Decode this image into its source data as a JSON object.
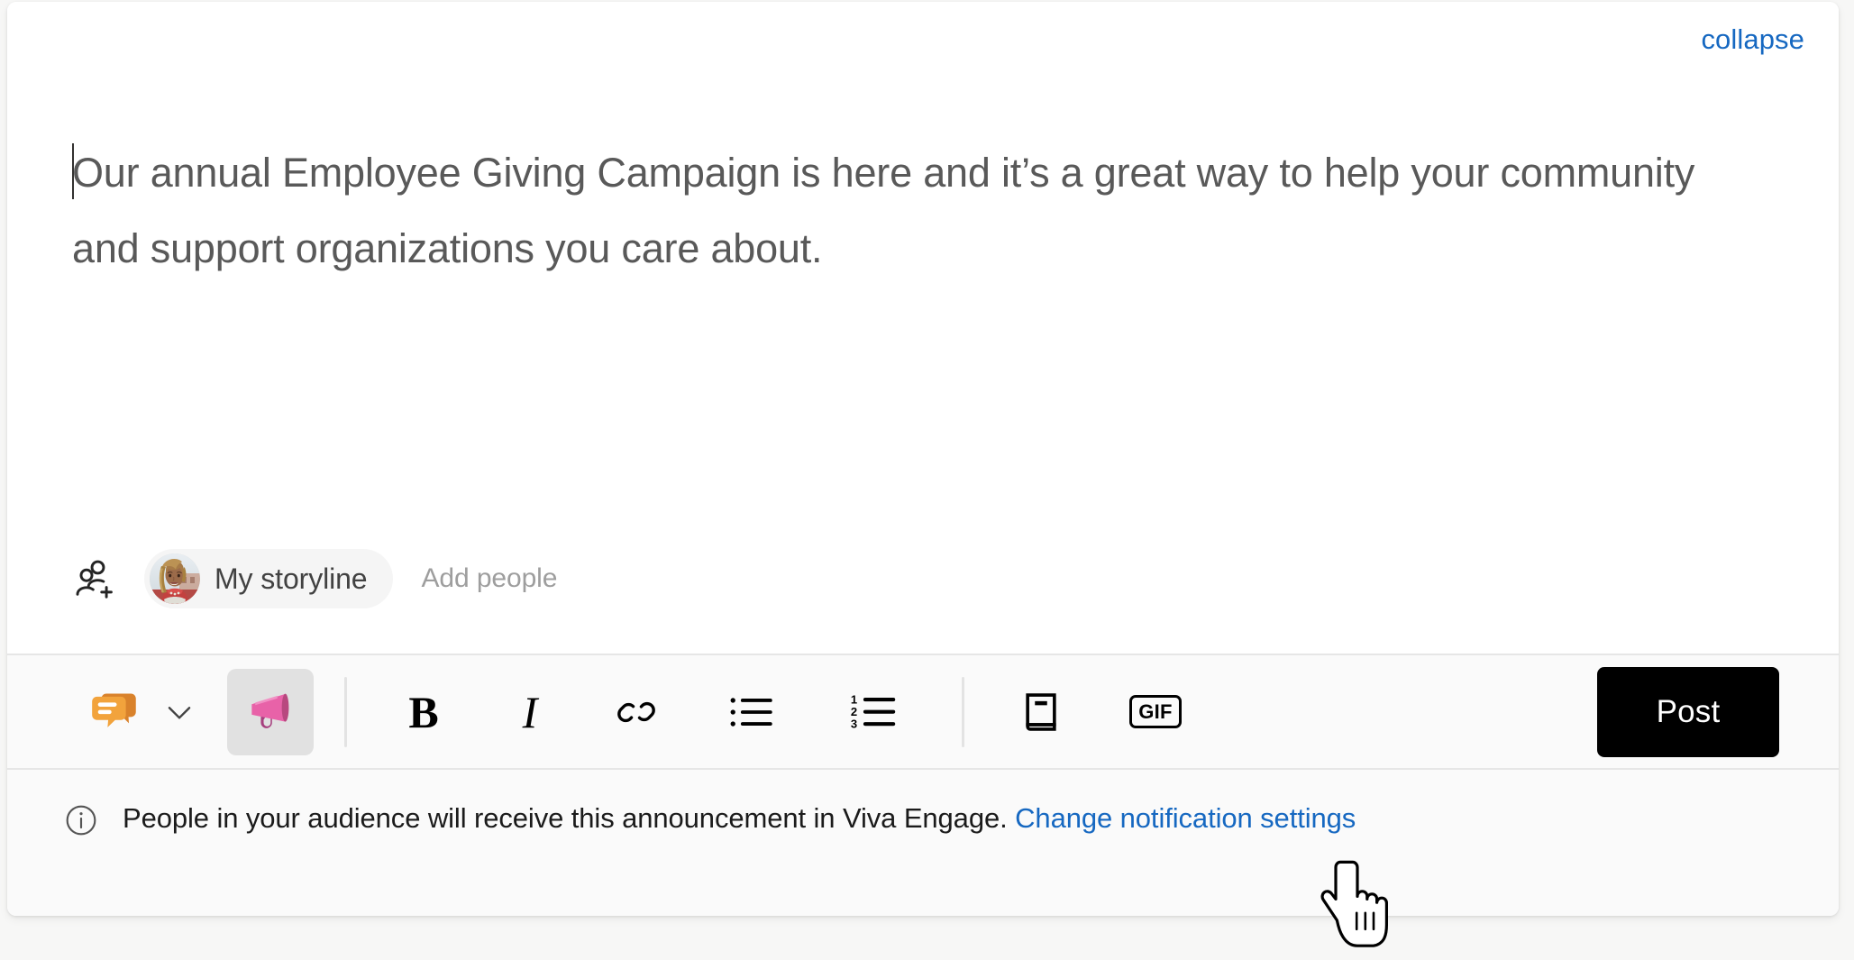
{
  "card": {
    "collapse_label": "collapse"
  },
  "editor": {
    "body_text": "Our annual Employee Giving Campaign is here and it’s a great way to help your community and support organizations you care about.",
    "caret_visible": true
  },
  "audience": {
    "add_audience_icon": "add-people-icon",
    "selected_audience": "My storyline",
    "add_people_placeholder": "Add people",
    "avatar_alt": "user-avatar"
  },
  "toolbar": {
    "post_type_icon": "discussion-icon",
    "post_type_chevron": "chevron-down-icon",
    "announcement_icon": "megaphone-icon",
    "announcement_selected": true,
    "bold_label": "B",
    "italic_label": "I",
    "link_icon": "link-icon",
    "bulleted_list_icon": "bulleted-list-icon",
    "numbered_list_icon": "numbered-list-icon",
    "numbered_list_digits": [
      "1",
      "2",
      "3"
    ],
    "praise_icon": "book-icon",
    "gif_label": "GIF",
    "post_label": "Post"
  },
  "notice": {
    "icon": "info-icon",
    "text": "People in your audience will receive this announcement in Viva Engage.",
    "link_label": "Change notification settings"
  },
  "colors": {
    "link_blue": "#1668c1",
    "post_button_bg": "#000000",
    "post_button_text": "#ffffff",
    "body_text": "#595959",
    "placeholder": "#9e9e9e",
    "toolbar_bg": "#fafafa",
    "selected_tool_bg": "#e1e1e1",
    "discussion_orange": "#ee9a34",
    "megaphone_pink": "#e862a8"
  },
  "cursor": {
    "type": "pointing-hand-cursor"
  }
}
